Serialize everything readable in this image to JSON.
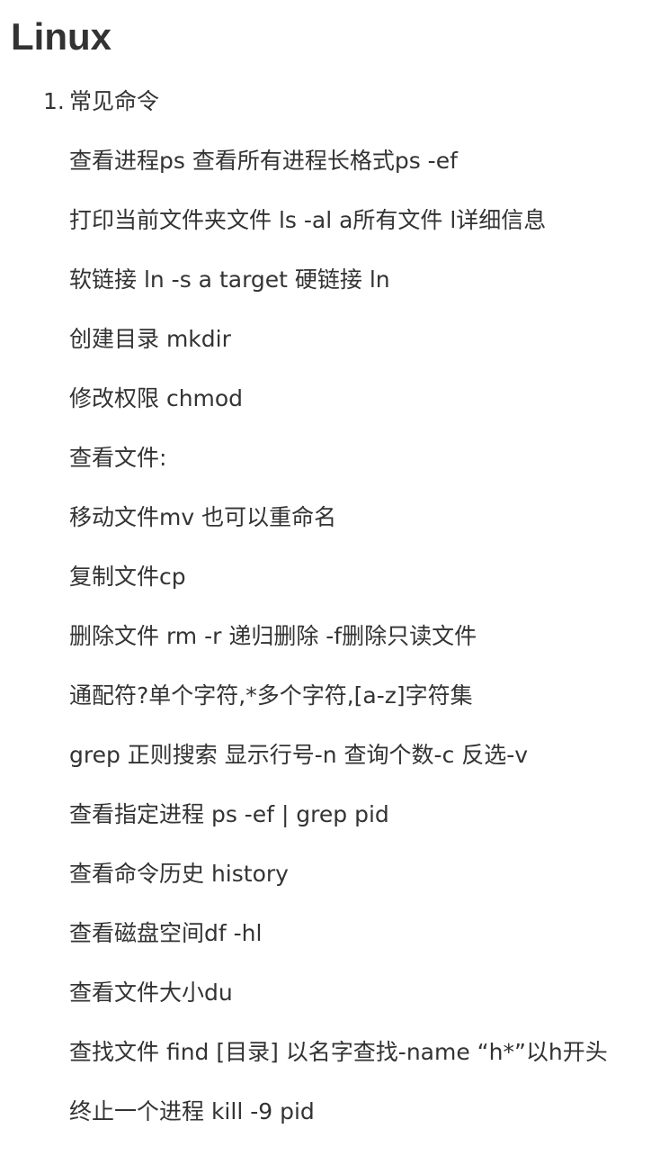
{
  "document": {
    "title": "Linux",
    "section": {
      "number": "1.",
      "heading": "常见命令"
    },
    "lines": [
      "查看进程ps 查看所有进程长格式ps -ef",
      "打印当前文件夹文件 ls -al a所有文件 l详细信息",
      "软链接 ln -s a target 硬链接 ln",
      "创建目录 mkdir",
      "修改权限 chmod",
      "查看文件:",
      "移动文件mv 也可以重命名",
      "复制文件cp",
      "删除文件 rm -r 递归删除 -f删除只读文件",
      "通配符?单个字符,*多个字符,[a-z]字符集",
      "grep 正则搜索 显示行号-n 查询个数-c 反选-v",
      "查看指定进程 ps -ef | grep pid",
      "查看命令历史 history",
      "查看磁盘空间df -hl",
      "查看文件大小du",
      "查找文件 find [目录] 以名字查找-name “h*”以h开头",
      "终止一个进程 kill -9 pid"
    ]
  }
}
